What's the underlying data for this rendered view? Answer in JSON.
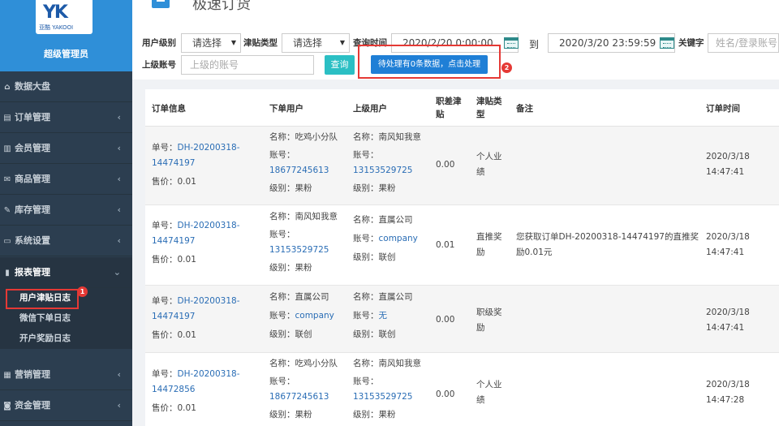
{
  "sidebar": {
    "brand_logo_text": "亚酷 YAKOOI",
    "role": "超级管理员",
    "items": [
      {
        "label": "数据大盘",
        "icon": "home-icon",
        "has_chevron": false
      },
      {
        "label": "订单管理",
        "icon": "order-icon",
        "has_chevron": true
      },
      {
        "label": "会员管理",
        "icon": "chart-icon",
        "has_chevron": true
      },
      {
        "label": "商品管理",
        "icon": "mail-icon",
        "has_chevron": true
      },
      {
        "label": "库存管理",
        "icon": "edit-icon",
        "has_chevron": true
      },
      {
        "label": "系统设置",
        "icon": "monitor-icon",
        "has_chevron": true
      },
      {
        "label": "报表管理",
        "icon": "bar-chart-icon",
        "has_chevron": true,
        "expanded": true
      },
      {
        "label": "营销管理",
        "icon": "book-icon",
        "has_chevron": true
      },
      {
        "label": "资金管理",
        "icon": "money-icon",
        "has_chevron": true
      }
    ],
    "submenu": [
      "用户津贴日志",
      "微信下单日志",
      "开户奖励日志"
    ]
  },
  "header": {
    "title": "极速订货"
  },
  "filters": {
    "user_level_label": "用户级别",
    "user_level_value": "请选择",
    "allowance_type_label": "津贴类型",
    "allowance_type_value": "请选择",
    "query_time_label": "查询时间",
    "start_time": "2020/2/20 0:00:00",
    "to_label": "到",
    "end_time": "2020/3/20 23:59:59",
    "keyword_label": "关键字",
    "keyword_placeholder": "姓名/登录账号",
    "superior_label": "上级账号",
    "superior_placeholder": "上级的账号",
    "query_button": "查询",
    "pending_button": "待处理有0条数据，点击处理",
    "badge1": "1",
    "badge2": "2"
  },
  "table": {
    "headers": [
      "订单信息",
      "下单用户",
      "上级用户",
      "职差津贴",
      "津贴类型",
      "备注",
      "订单时间"
    ],
    "rows": [
      {
        "order_no_label": "单号：",
        "order_no": "DH-20200318-14474197",
        "price": "售价：0.01",
        "buyer_name": "名称：吃鸡小分队",
        "buyer_account_label": "账号：",
        "buyer_account": "18677245613",
        "buyer_level": "级别：果粉",
        "sup_name": "名称：南风知我意",
        "sup_account_label": "账号：",
        "sup_account": "13153529725",
        "sup_level": "级别：果粉",
        "allowance": "0.00",
        "type": "个人业绩",
        "remark": "",
        "date": "2020/3/18",
        "time": "14:47:41"
      },
      {
        "order_no_label": "单号：",
        "order_no": "DH-20200318-14474197",
        "price": "售价：0.01",
        "buyer_name": "名称：南风知我意",
        "buyer_account_label": "账号：",
        "buyer_account": "13153529725",
        "buyer_level": "级别：果粉",
        "sup_name": "名称：直属公司",
        "sup_account_label": "账号：",
        "sup_account": "company",
        "sup_level": "级别：联创",
        "allowance": "0.01",
        "type": "直推奖励",
        "remark": "您获取订单DH-20200318-14474197的直推奖励0.01元",
        "date": "2020/3/18",
        "time": "14:47:41"
      },
      {
        "order_no_label": "单号：",
        "order_no": "DH-20200318-14474197",
        "price": "售价：0.01",
        "buyer_name": "名称：直属公司",
        "buyer_account_label": "账号：",
        "buyer_account": "company",
        "buyer_level": "级别：联创",
        "sup_name": "名称：直属公司",
        "sup_account_label": "账号：",
        "sup_account": "无",
        "sup_level": "级别：联创",
        "allowance": "0.00",
        "type": "职级奖励",
        "remark": "",
        "date": "2020/3/18",
        "time": "14:47:41"
      },
      {
        "order_no_label": "单号：",
        "order_no": "DH-20200318-14472856",
        "price": "售价：0.01",
        "buyer_name": "名称：吃鸡小分队",
        "buyer_account_label": "账号：",
        "buyer_account": "18677245613",
        "buyer_level": "级别：果粉",
        "sup_name": "名称：南风知我意",
        "sup_account_label": "账号：",
        "sup_account": "13153529725",
        "sup_level": "级别：果粉",
        "allowance": "0.00",
        "type": "个人业绩",
        "remark": "",
        "date": "2020/3/18",
        "time": "14:47:28"
      }
    ]
  }
}
